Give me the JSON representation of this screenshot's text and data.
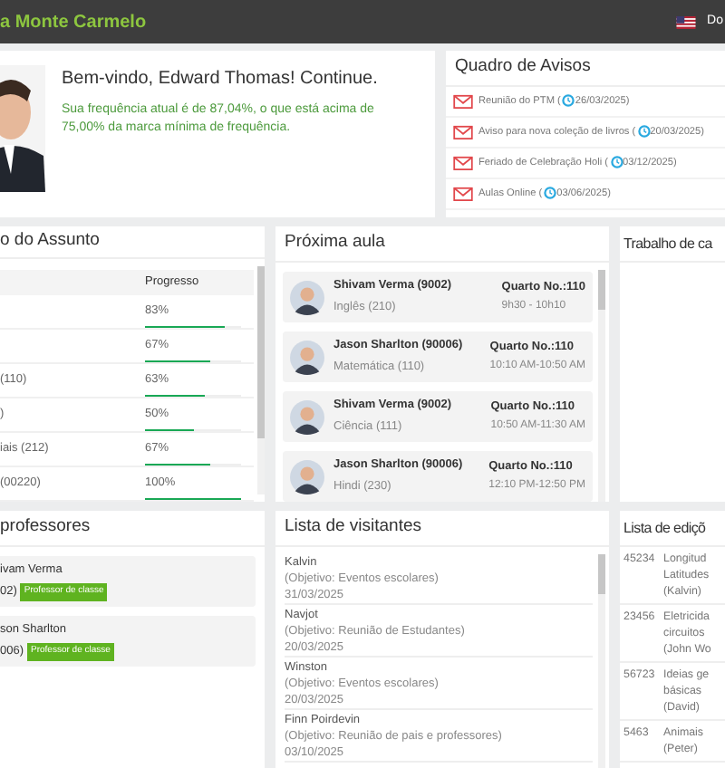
{
  "header": {
    "title": "a Monte Carmelo",
    "user": "Do"
  },
  "welcome": {
    "heading": "Bem-vindo, Edward Thomas! Continue.",
    "message": "Sua frequência atual é de 87,04%, o que está acima de 75,00% da marca mínima de frequência."
  },
  "notices": {
    "title": "Quadro de Avisos",
    "items": [
      {
        "text": "Reunião do PTM (",
        "date": "26/03/2025)"
      },
      {
        "text": "Aviso para nova coleção de livros (",
        "date": "20/03/2025)"
      },
      {
        "text": "Feriado de Celebração Holi (",
        "date": "03/12/2025)"
      },
      {
        "text": "Aulas Online (",
        "date": "03/06/2025)"
      }
    ]
  },
  "subjects": {
    "title": "o do Assunto",
    "progress_header": "Progresso",
    "rows": [
      {
        "subject": "",
        "reading": "83%",
        "level": 0.83
      },
      {
        "subject": "",
        "reading": "67%",
        "level": 0.67
      },
      {
        "subject": "(110)",
        "reading": "63%",
        "level": 0.63
      },
      {
        "subject": ")",
        "reading": "50%",
        "level": 0.5
      },
      {
        "subject": "iais (212)",
        "reading": "67%",
        "level": 0.67
      },
      {
        "subject": "(00220)",
        "reading": "100%",
        "level": 1
      }
    ]
  },
  "next_class": {
    "title": "Próxima aula",
    "items": [
      {
        "teacher": "Shivam Verma (9002)",
        "subject": "Inglês (210)",
        "room": "Quarto No.:110",
        "time": "9h30 - 10h10"
      },
      {
        "teacher": "Jason Sharlton (90006)",
        "subject": "Matemática (110)",
        "room": "Quarto No.:110",
        "time": "10:10 AM-10:50 AM"
      },
      {
        "teacher": "Shivam Verma (9002)",
        "subject": "Ciência (111)",
        "room": "Quarto No.:110",
        "time": "10:50 AM-11:30 AM"
      },
      {
        "teacher": "Jason Sharlton (90006)",
        "subject": "Hindi (230)",
        "room": "Quarto No.:110",
        "time": "12:10 PM-12:50 PM"
      }
    ]
  },
  "homework": {
    "title": "Trabalho de ca"
  },
  "teachers": {
    "title": "professores",
    "items": [
      {
        "name": "ivam Verma",
        "id": "02)",
        "badge": "Professor de classe"
      },
      {
        "name": "son Sharlton",
        "id": "006)",
        "badge": "Professor de classe"
      }
    ]
  },
  "visitors": {
    "title": "Lista de visitantes",
    "items": [
      {
        "name": "Kalvin",
        "purpose": "(Objetivo: Eventos escolares)",
        "date": "31/03/2025"
      },
      {
        "name": "Navjot",
        "purpose": "(Objetivo: Reunião de Estudantes)",
        "date": "20/03/2025"
      },
      {
        "name": "Winston",
        "purpose": "(Objetivo: Eventos escolares)",
        "date": "20/03/2025"
      },
      {
        "name": "Finn Poirdevin",
        "purpose": "(Objetivo: Reunião de pais e professores)",
        "date": "03/10/2025"
      }
    ]
  },
  "editions": {
    "title": "Lista de ediçõ",
    "rows": [
      {
        "id": "45234",
        "lines": [
          "Longitud",
          "Latitudes",
          "(Kalvin)"
        ]
      },
      {
        "id": "23456",
        "lines": [
          "Eletricida",
          "circuitos",
          "(John Wo"
        ]
      },
      {
        "id": "56723",
        "lines": [
          "Ideias ge",
          "básicas",
          "(David)"
        ]
      },
      {
        "id": "5463",
        "lines": [
          "Animais",
          "(Peter)"
        ]
      }
    ]
  }
}
